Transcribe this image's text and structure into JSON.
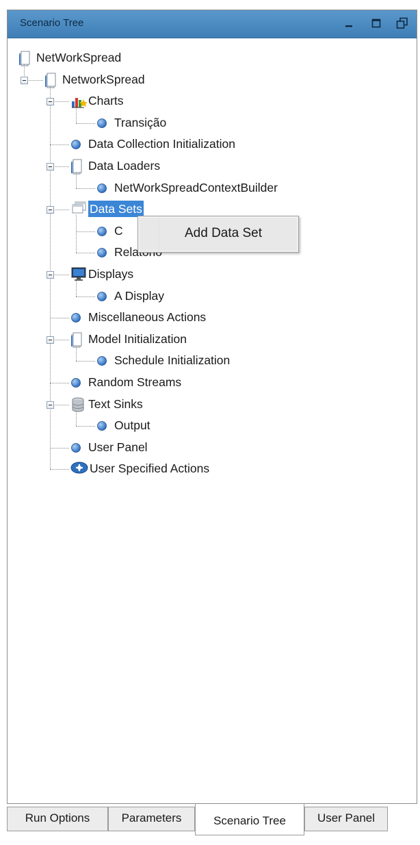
{
  "panel": {
    "title": "Scenario Tree",
    "buttons": {
      "minimize": "minimize-icon",
      "maximize": "maximize-icon",
      "restore": "restore-icon"
    }
  },
  "tree": {
    "nodes": [
      {
        "label": "NetWorkSpread",
        "icon": "document-icon",
        "level": 0
      },
      {
        "label": "NetworkSpread",
        "icon": "document-icon",
        "level": 1,
        "expanded": true
      },
      {
        "label": "Charts",
        "icon": "chart-icon",
        "level": 2,
        "expanded": true
      },
      {
        "label": "Transição",
        "icon": "bullet-icon",
        "level": 3
      },
      {
        "label": "Data Collection Initialization",
        "icon": "bullet-icon",
        "level": 2
      },
      {
        "label": "Data Loaders",
        "icon": "document-icon",
        "level": 2,
        "expanded": true
      },
      {
        "label": "NetWorkSpreadContextBuilder",
        "icon": "bullet-icon",
        "level": 3
      },
      {
        "label": "Data Sets",
        "icon": "windows-icon",
        "level": 2,
        "expanded": true,
        "selected": true
      },
      {
        "label": "C",
        "icon": "bullet-icon",
        "level": 3
      },
      {
        "label": "Relatorio",
        "icon": "bullet-icon",
        "level": 3
      },
      {
        "label": "Displays",
        "icon": "monitor-icon",
        "level": 2,
        "expanded": true
      },
      {
        "label": "A Display",
        "icon": "bullet-icon",
        "level": 3
      },
      {
        "label": "Miscellaneous Actions",
        "icon": "bullet-icon",
        "level": 2
      },
      {
        "label": "Model Initialization",
        "icon": "document-icon",
        "level": 2,
        "expanded": true
      },
      {
        "label": "Schedule Initialization",
        "icon": "bullet-icon",
        "level": 3
      },
      {
        "label": "Random Streams",
        "icon": "bullet-icon",
        "level": 2
      },
      {
        "label": "Text Sinks",
        "icon": "database-icon",
        "level": 2,
        "expanded": true
      },
      {
        "label": "Output",
        "icon": "bullet-icon",
        "level": 3
      },
      {
        "label": "User Panel",
        "icon": "bullet-icon",
        "level": 2
      },
      {
        "label": "User Specified Actions",
        "icon": "user-actions-icon",
        "level": 2
      }
    ]
  },
  "context_menu": {
    "items": [
      {
        "label": "Add Data Set"
      }
    ]
  },
  "tabs": [
    {
      "label": "Run Options",
      "active": false
    },
    {
      "label": "Parameters",
      "active": false
    },
    {
      "label": "Scenario Tree",
      "active": true
    },
    {
      "label": "User Panel",
      "active": false
    }
  ],
  "colors": {
    "title_bar": "#4a8ac2",
    "selection": "#3b86d6",
    "bullet": "#2f6fbf"
  }
}
